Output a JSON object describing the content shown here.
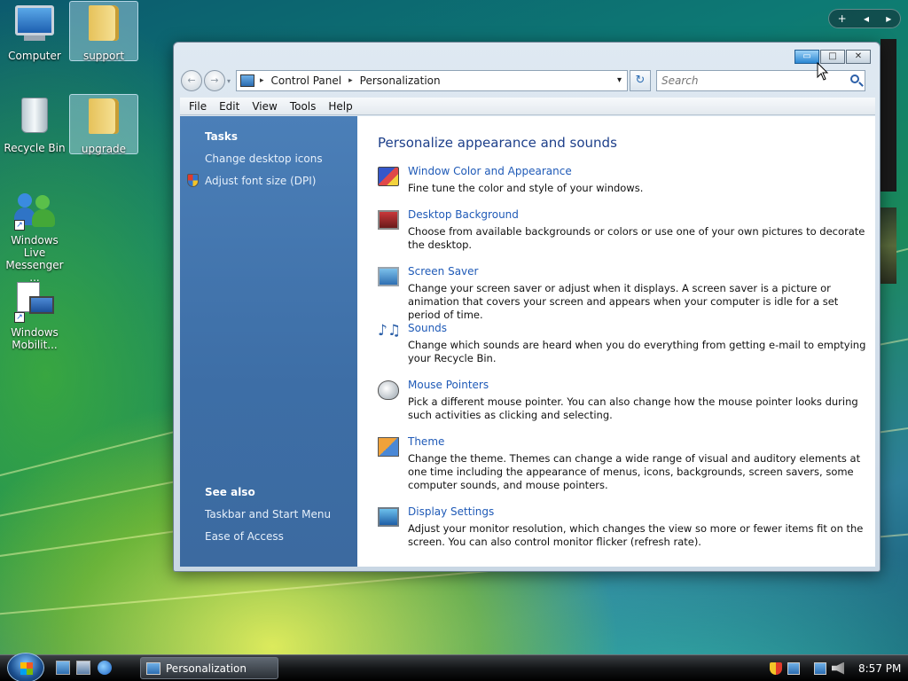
{
  "desktop": {
    "icons": [
      {
        "label": "Computer"
      },
      {
        "label": "support"
      },
      {
        "label": "Recycle Bin"
      },
      {
        "label": "upgrade"
      },
      {
        "label": "Windows Live Messenger ..."
      },
      {
        "label": "Windows Mobilit..."
      }
    ]
  },
  "gadget_bar": {
    "add": "+",
    "prev": "◂",
    "next": "▸"
  },
  "window": {
    "controls": {
      "minimize": "▭",
      "maximize": "□",
      "close": "✕"
    },
    "nav": {
      "back": "←",
      "forward": "→",
      "dropdown": "▾"
    },
    "address": {
      "crumbs": [
        "Control Panel",
        "Personalization"
      ],
      "separator": "▸",
      "dropdown": "▾",
      "refresh": "↻"
    },
    "search": {
      "placeholder": "Search"
    },
    "menu": [
      "File",
      "Edit",
      "View",
      "Tools",
      "Help"
    ],
    "sidebar": {
      "tasks_heading": "Tasks",
      "tasks": [
        "Change desktop icons",
        "Adjust font size (DPI)"
      ],
      "see_also_heading": "See also",
      "see_also": [
        "Taskbar and Start Menu",
        "Ease of Access"
      ]
    },
    "content": {
      "title": "Personalize appearance and sounds",
      "sections": [
        {
          "icon": "window-color-icon",
          "title": "Window Color and Appearance",
          "desc": "Fine tune the color and style of your windows."
        },
        {
          "icon": "desktop-background-icon",
          "title": "Desktop Background",
          "desc": "Choose from available backgrounds or colors or use one of your own pictures to decorate the desktop."
        },
        {
          "icon": "screen-saver-icon",
          "title": "Screen Saver",
          "desc": "Change your screen saver or adjust when it displays. A screen saver is a picture or animation that covers your screen and appears when your computer is idle for a set period of time."
        },
        {
          "icon": "sounds-icon",
          "title": "Sounds",
          "desc": "Change which sounds are heard when you do everything from getting e-mail to emptying your Recycle Bin."
        },
        {
          "icon": "mouse-pointer-icon",
          "title": "Mouse Pointers",
          "desc": "Pick a different mouse pointer. You can also change how the mouse pointer looks during such activities as clicking and selecting."
        },
        {
          "icon": "theme-icon",
          "title": "Theme",
          "desc": "Change the theme. Themes can change a wide range of visual and auditory elements at one time including the appearance of menus, icons, backgrounds, screen savers, some computer sounds, and mouse pointers."
        },
        {
          "icon": "display-settings-icon",
          "title": "Display Settings",
          "desc": "Adjust your monitor resolution, which changes the view so more or fewer items fit on the screen. You can also control monitor flicker (refresh rate)."
        }
      ]
    }
  },
  "taskbar": {
    "task_button": "Personalization",
    "clock": "8:57 PM"
  }
}
